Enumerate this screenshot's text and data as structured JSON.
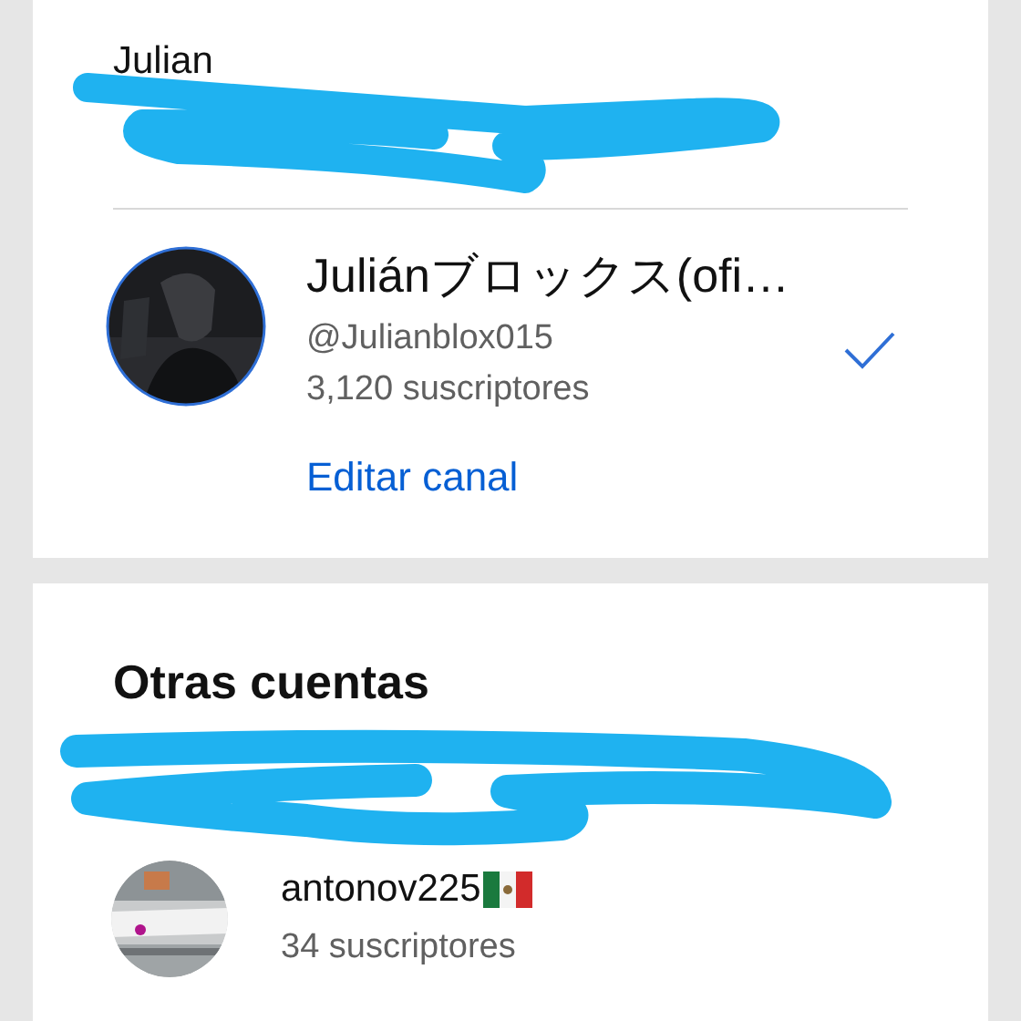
{
  "current_account": {
    "label": "Julian",
    "name": "Juliánブロックス(ofi…",
    "handle": "@Julianblox015",
    "subscribers": "3,120 suscriptores",
    "selected": true,
    "edit_link": "Editar canal"
  },
  "other_accounts": {
    "title": "Otras cuentas",
    "accounts": [
      {
        "name": "antonov225",
        "flag": true,
        "subscribers": "34 suscriptores",
        "selected": false
      }
    ]
  }
}
